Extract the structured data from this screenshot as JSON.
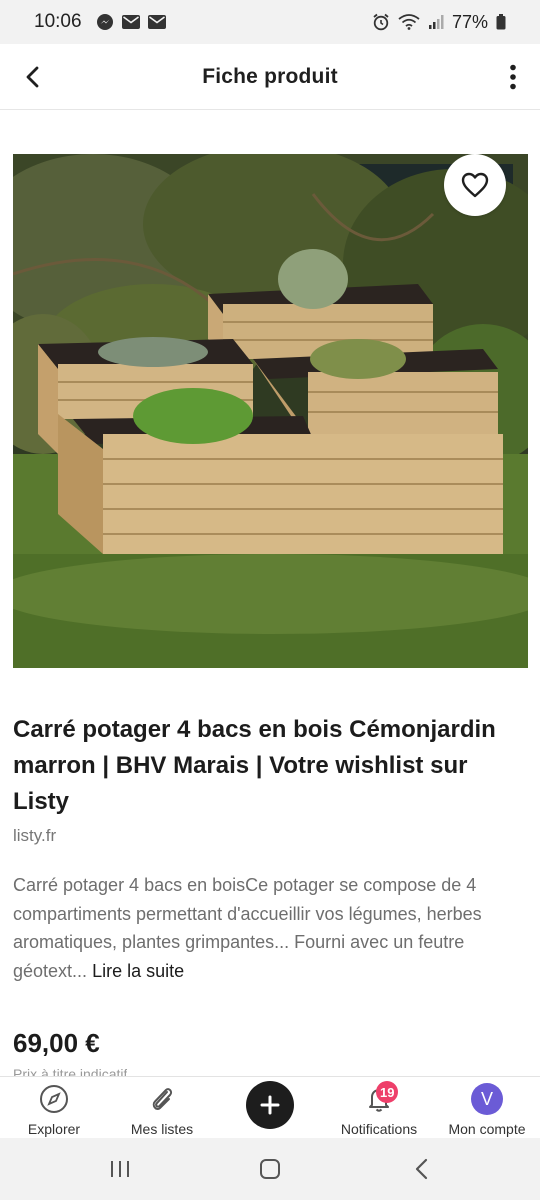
{
  "status_bar": {
    "time": "10:06",
    "battery": "77%",
    "icons": [
      "messenger-icon",
      "mail-icon",
      "mail-icon",
      "alarm-icon",
      "wifi-icon",
      "signal-icon",
      "battery-icon"
    ]
  },
  "app_bar": {
    "title": "Fiche produit",
    "back_icon": "chevron-left-icon",
    "more_icon": "more-vertical-icon"
  },
  "product": {
    "image_alt": "Carré potager 4 bacs en bois",
    "favorite_icon": "heart-outline-icon",
    "title": "Carré potager 4 bacs en bois Cémonjardin marron | BHV Marais | Votre wishlist sur Listy",
    "domain": "listy.fr",
    "description": "Carré potager 4 bacs en boisCe potager se compose de 4 compartiments permettant d'accueillir vos légumes, herbes aromatiques, plantes grimpantes... Fourni avec un feutre géotext...",
    "read_more": "Lire la suite",
    "price": "69,00 €",
    "price_note": "Prix à titre indicatif"
  },
  "bottom_nav": {
    "items": [
      {
        "label": "Explorer",
        "icon": "compass-icon"
      },
      {
        "label": "Mes listes",
        "icon": "paperclip-icon"
      },
      {
        "label": "",
        "icon": "plus-icon"
      },
      {
        "label": "Notifications",
        "icon": "bell-icon",
        "badge": "19"
      },
      {
        "label": "Mon compte",
        "icon": "avatar",
        "avatar_letter": "V"
      }
    ]
  },
  "colors": {
    "badge": "#ee3f6a",
    "avatar": "#6b5bd6",
    "add_button": "#1d1d1d"
  }
}
